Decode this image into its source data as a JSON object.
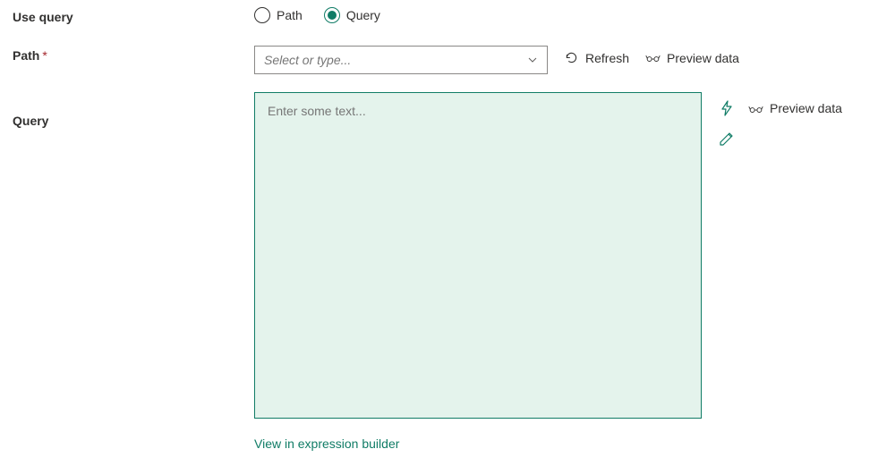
{
  "labels": {
    "use_query": "Use query",
    "path": "Path",
    "query": "Query"
  },
  "radio": {
    "path_option": "Path",
    "query_option": "Query",
    "selected": "Query"
  },
  "path_field": {
    "placeholder": "Select or type..."
  },
  "actions": {
    "refresh": "Refresh",
    "preview_data": "Preview data"
  },
  "query_field": {
    "placeholder": "Enter some text...",
    "preview_data": "Preview data"
  },
  "links": {
    "expression_builder": "View in expression builder"
  }
}
